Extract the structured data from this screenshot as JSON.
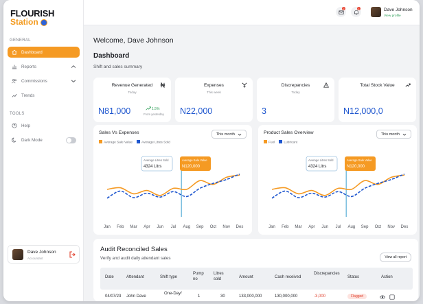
{
  "brand": {
    "line1": "FLOURISH",
    "line2": "Station"
  },
  "sidebar": {
    "general_title": "GENERAL",
    "tools_title": "TOOLS",
    "items": [
      {
        "label": "Dashboard",
        "icon": "home-icon"
      },
      {
        "label": "Reports",
        "icon": "bar-chart-icon"
      },
      {
        "label": "Commissions",
        "icon": "users-icon"
      },
      {
        "label": "Trends",
        "icon": "trend-icon"
      }
    ],
    "tools": [
      {
        "label": "Help",
        "icon": "help-icon"
      },
      {
        "label": "Dark Mode",
        "icon": "moon-icon"
      }
    ],
    "user": {
      "name": "Dave Johnson",
      "role": "Accountant"
    }
  },
  "topbar": {
    "mail_count": "2",
    "notif_count": "1",
    "user_name": "Dave Johnson",
    "view_profile": "View profile"
  },
  "welcome": "Welcome,  Dave Johnson",
  "page": {
    "title": "Dashboard",
    "subtitle": "Shift and sales summary"
  },
  "kpis": [
    {
      "title": "Revenue Generated",
      "sub": "Today",
      "value": "N81,000",
      "change": "1.5%",
      "change_sub": "From yesterday",
      "icon": "naira-icon"
    },
    {
      "title": "Expenses",
      "sub": "This week",
      "value": "N22,000",
      "icon": "pump-icon"
    },
    {
      "title": "Discrepancies",
      "sub": "Today",
      "value": "3",
      "icon": "warning-icon"
    },
    {
      "title": "Total Stock Value",
      "sub": "",
      "value": "N12,000,0",
      "icon": "trend-up-icon"
    }
  ],
  "colors": {
    "accent": "#f59a23",
    "blue": "#1f57cf",
    "green": "#2e9e58",
    "red": "#e0422f"
  },
  "charts": {
    "sales": {
      "title": "Sales Vs Expenses",
      "period": "This month",
      "legend": [
        "Average Sale Value",
        "Average Litres Sold"
      ],
      "tip_left_label": "Average Litres Sold",
      "tip_left_value": "4324 Litrs",
      "tip_right_label": "Average Sale Value",
      "tip_right_value": "N120,000"
    },
    "product": {
      "title": "Product Sales Overview",
      "period": "This month",
      "legend": [
        "Fuel",
        "Lubricant"
      ],
      "tip_left_label": "Average Litres Sold",
      "tip_left_value": "4324 Litrs",
      "tip_right_label": "Average Sale Value",
      "tip_right_value": "N120,000"
    }
  },
  "chart_data": [
    {
      "type": "line",
      "title": "Sales Vs Expenses",
      "categories": [
        "Jan",
        "Feb",
        "Mar",
        "Apr",
        "Jun",
        "Jul",
        "Aug",
        "Sep",
        "Oct",
        "Nov",
        "Des"
      ],
      "series": [
        {
          "name": "Average Sale Value",
          "color": "#f59a23",
          "values": [
            6.0,
            6.3,
            5.2,
            5.8,
            4.9,
            6.2,
            6.0,
            7.6,
            6.9,
            8.2,
            8.6
          ]
        },
        {
          "name": "Average Litres Sold",
          "color": "#1f57cf",
          "values": [
            4.4,
            5.7,
            4.5,
            5.3,
            4.6,
            5.6,
            4.7,
            6.2,
            7.1,
            7.8,
            8.8
          ]
        }
      ],
      "annotations": [
        "Average Litres Sold 4324 Litrs",
        "Average Sale Value N120,000"
      ]
    },
    {
      "type": "line",
      "title": "Product Sales Overview",
      "categories": [
        "Jan",
        "Feb",
        "Mar",
        "Apr",
        "Jun",
        "Jul",
        "Aug",
        "Sep",
        "Oct",
        "Nov",
        "Des"
      ],
      "series": [
        {
          "name": "Fuel",
          "color": "#f59a23",
          "values": [
            6.0,
            6.3,
            5.2,
            5.8,
            4.9,
            6.2,
            6.0,
            7.6,
            6.9,
            8.2,
            8.6
          ]
        },
        {
          "name": "Lubricant",
          "color": "#1f57cf",
          "values": [
            4.4,
            5.7,
            4.5,
            5.3,
            4.6,
            5.6,
            4.7,
            6.2,
            7.1,
            7.8,
            8.8
          ]
        }
      ],
      "annotations": [
        "Average Litres Sold 4324 Litrs",
        "Average Sale Value N120,000"
      ]
    }
  ],
  "audit": {
    "title": "Audit Reconciled Sales",
    "subtitle": "Verify and audit daily attendant sales",
    "view_all": "View all report",
    "headers": [
      "Date",
      "Attendant",
      "Shift type",
      "Pump no",
      "Litres sold",
      "Amount",
      "Cash received",
      "Discrepancies",
      "Status",
      "Action"
    ],
    "row": [
      "04/07/23",
      "John Dave",
      "One-Day/",
      "1",
      "30",
      "133,000,000",
      "130,000,000",
      "-3,000",
      "Flagged"
    ]
  }
}
